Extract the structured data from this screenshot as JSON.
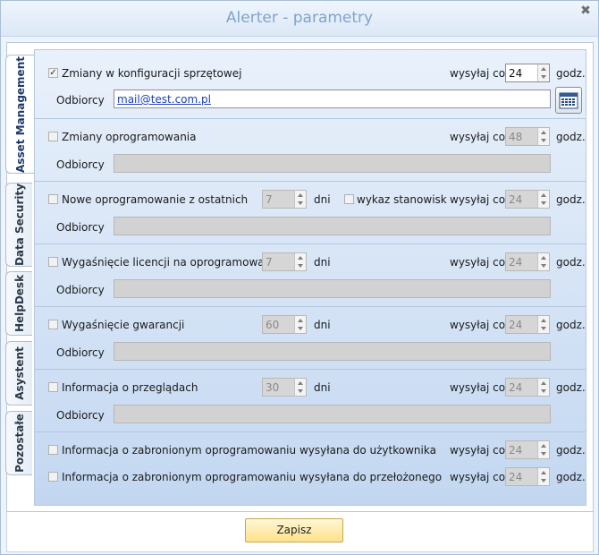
{
  "window": {
    "title": "Alerter - parametry",
    "close_glyph": "✖"
  },
  "tabs": [
    {
      "label": "Asset Management",
      "active": true
    },
    {
      "label": "Data Security",
      "active": false
    },
    {
      "label": "HelpDesk",
      "active": false
    },
    {
      "label": "Asystent",
      "active": false
    },
    {
      "label": "Pozostałe",
      "active": false
    }
  ],
  "common": {
    "send_every": "wysyłaj co",
    "hours": "godz.",
    "days": "dni",
    "recipients": "Odbiorcy"
  },
  "sections": {
    "hardware": {
      "label": "Zmiany w konfiguracji sprzętowej",
      "checked": true,
      "hours": "24",
      "recipients": "mail@test.com.pl"
    },
    "software": {
      "label": "Zmiany oprogramowania",
      "checked": false,
      "hours": "48",
      "recipients": ""
    },
    "new_software": {
      "label": "Nowe oprogramowanie z ostatnich",
      "checked": false,
      "days": "7",
      "workstations_label": "wykaz stanowisk",
      "workstations_checked": false,
      "hours": "24",
      "recipients": ""
    },
    "license": {
      "label": "Wygaśnięcie licencji na oprogramowanie",
      "checked": false,
      "days": "7",
      "hours": "24",
      "recipients": ""
    },
    "warranty": {
      "label": "Wygaśnięcie gwarancji",
      "checked": false,
      "days": "60",
      "hours": "24",
      "recipients": ""
    },
    "inspection": {
      "label": "Informacja o przeglądach",
      "checked": false,
      "days": "30",
      "hours": "24",
      "recipients": ""
    },
    "forbidden_user": {
      "label": "Informacja o zabronionym oprogramowaniu wysyłana do użytkownika",
      "checked": false,
      "hours": "24"
    },
    "forbidden_supervisor": {
      "label": "Informacja o zabronionym oprogramowaniu wysyłana do przełożonego",
      "checked": false,
      "hours": "24"
    }
  },
  "footer": {
    "save_label": "Zapisz"
  },
  "icons": {
    "checkbox_check": "✓",
    "calendar": "calendar-icon"
  },
  "colors": {
    "accent": "#7fa3cf",
    "save_button": "#fde28a"
  }
}
